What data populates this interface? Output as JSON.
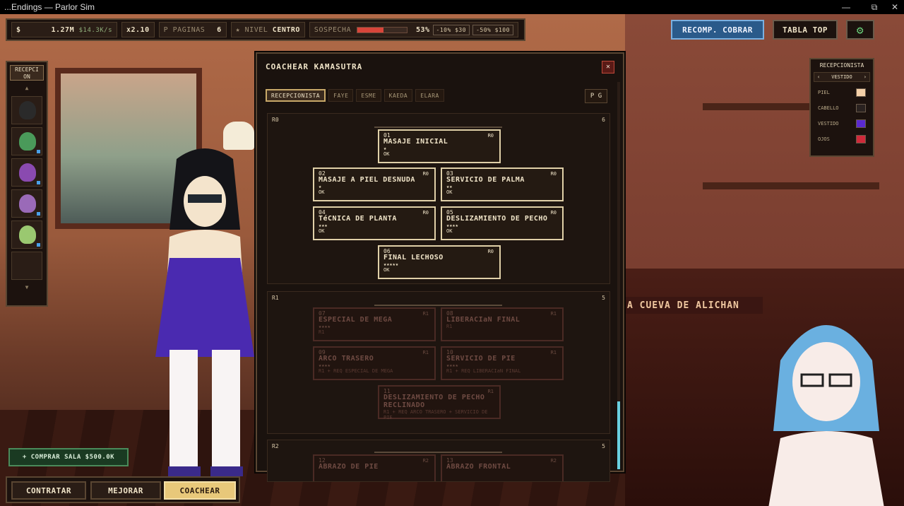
{
  "window": {
    "title": "...Endings — Parlor Sim",
    "minimize": "—",
    "maximize": "⧉",
    "close": "✕"
  },
  "hud": {
    "money_symbol": "$",
    "money": "1.27M",
    "rate": "$14.3K/s",
    "multiplier": "x2.10",
    "pages_label": "P PAGINAS",
    "pages": "6",
    "level_label": "★ NIVEL",
    "level": "CENTRO",
    "suspicion_label": "SOSPECHA",
    "suspicion_value": "53%",
    "suspicion_level": 0.53,
    "chip1": "-10% $30",
    "chip2": "-50% $100"
  },
  "top_buttons": {
    "recomp": "RECOMP. COBRAR",
    "tabla": "TABLA TOP",
    "settings_icon": "gear-icon"
  },
  "roster": {
    "header": "RECEPCI\nON",
    "up": "▲",
    "down": "▼",
    "faces": [
      "#2a2a2a",
      "#4a9a5a",
      "#8a4ab0",
      "#9a6ab8",
      "#9ac870"
    ]
  },
  "buy_room": "+ COMPRAR SALA $500.0K",
  "bottom": {
    "contratar": "CONTRATAR",
    "mejorar": "MEJORAR",
    "coachear": "COACHEAR"
  },
  "appearance": {
    "title": "RECEPCIONISTA",
    "selector": "VESTIDO",
    "prev": "‹",
    "next": "›",
    "rows": [
      {
        "label": "PIEL",
        "color": "#f4d0a8"
      },
      {
        "label": "CABELLO",
        "color": "#2a2220"
      },
      {
        "label": "VESTIDO",
        "color": "#5a2ad0"
      },
      {
        "label": "OJOS",
        "color": "#d02a3a"
      }
    ]
  },
  "banner": "A CUEVA DE ALICHAN",
  "modal": {
    "title": "COACHEAR KAMASUTRA",
    "close": "✕",
    "tabs": [
      "RECEPCIONISTA",
      "FAYE",
      "ESME",
      "KAEDA",
      "ELARA"
    ],
    "pg": "P G",
    "ranks": [
      {
        "label": "R0",
        "count": "6",
        "nodes": [
          {
            "num": "01",
            "rank": "R0",
            "name": "MASAJE INICIAL",
            "stars": "★",
            "status": "OK"
          },
          {
            "num": "02",
            "rank": "R0",
            "name": "MASAJE A PIEL DESNUDA",
            "stars": "★",
            "status": "OK"
          },
          {
            "num": "03",
            "rank": "R0",
            "name": "SERVICIO DE PALMA",
            "stars": "★★",
            "status": "OK"
          },
          {
            "num": "04",
            "rank": "R0",
            "name": "TéCNICA DE PLANTA",
            "stars": "★★★",
            "status": "OK"
          },
          {
            "num": "05",
            "rank": "R0",
            "name": "DESLIZAMIENTO DE PECHO",
            "stars": "★★★★",
            "status": "OK"
          },
          {
            "num": "06",
            "rank": "R0",
            "name": "FINAL LECHOSO",
            "stars": "★★★★★",
            "status": "OK"
          }
        ]
      },
      {
        "label": "R1",
        "count": "5",
        "nodes": [
          {
            "num": "07",
            "rank": "R1",
            "name": "ESPECIAL DE MEGA",
            "stars": "★★★★",
            "status": "R1"
          },
          {
            "num": "08",
            "rank": "R1",
            "name": "LIBERACIaN FINAL",
            "stars": "",
            "status": "R1"
          },
          {
            "num": "09",
            "rank": "R1",
            "name": "ARCO TRASERO",
            "stars": "★★★★",
            "status": "R1 + REQ ESPECIAL DE MEGA"
          },
          {
            "num": "10",
            "rank": "R1",
            "name": "SERVICIO DE PIE",
            "stars": "★★★★",
            "status": "R1 + REQ LIBERACIaN FINAL"
          },
          {
            "num": "11",
            "rank": "R1",
            "name": "DESLIZAMIENTO DE PECHO RECLINADO",
            "stars": "",
            "status": "R1 + REQ ARCO TRASERO + SERVICIO DE PIE"
          }
        ]
      },
      {
        "label": "R2",
        "count": "5",
        "nodes": [
          {
            "num": "12",
            "rank": "R2",
            "name": "ABRAZO DE PIE",
            "stars": "",
            "status": ""
          },
          {
            "num": "13",
            "rank": "R2",
            "name": "ABRAZO FRONTAL",
            "stars": "",
            "status": ""
          }
        ]
      }
    ]
  }
}
